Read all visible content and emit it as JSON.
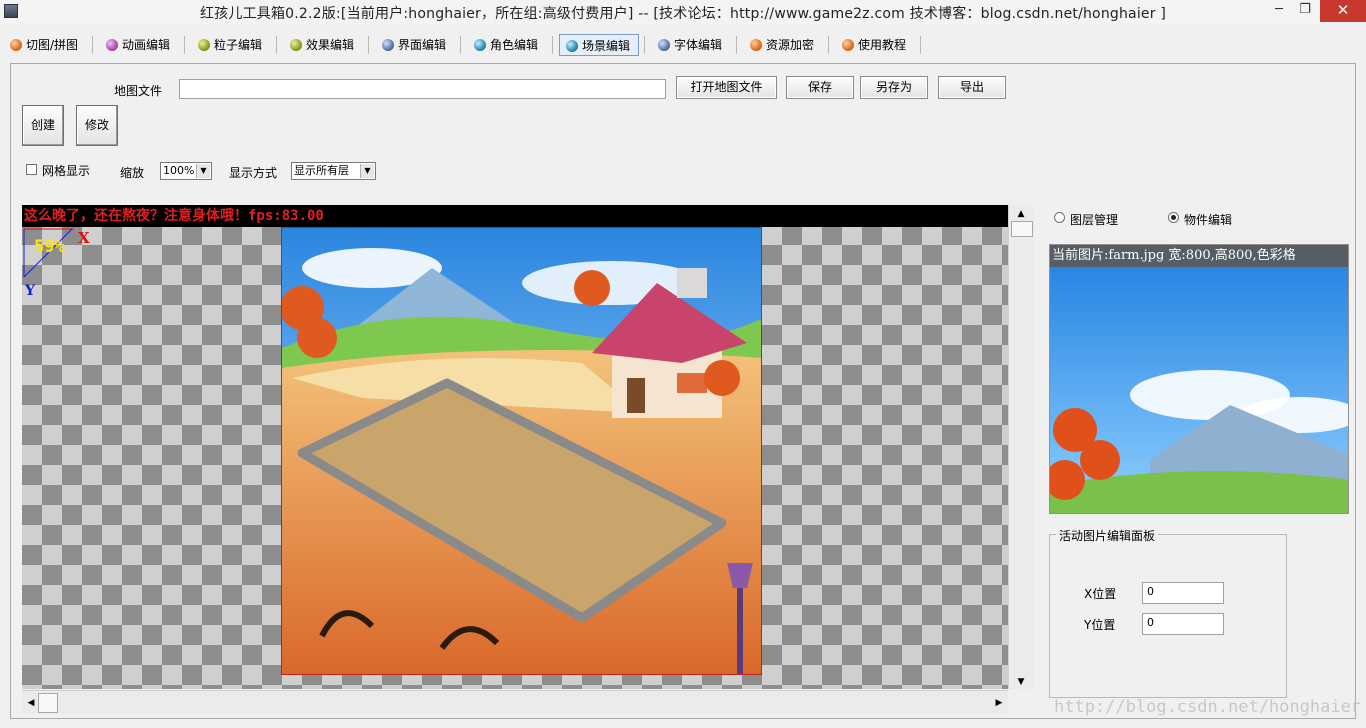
{
  "window": {
    "title": "红孩儿工具箱0.2.2版:[当前用户:honghaier，所在组:高级付费用户]  --  [技术论坛：http://www.game2z.com 技术博客：blog.csdn.net/honghaier ]",
    "min_glyph": "─",
    "max_glyph": "❐",
    "close_glyph": "✕"
  },
  "tabs": [
    {
      "label": "切图/拼图",
      "icon": "orange-ball-icon",
      "color": "#e07020"
    },
    {
      "label": "动画编辑",
      "icon": "purple-ball-icon",
      "color": "#b04bb0"
    },
    {
      "label": "粒子编辑",
      "icon": "olive-ball-icon",
      "color": "#8ea020"
    },
    {
      "label": "效果编辑",
      "icon": "olive-ball-icon",
      "color": "#8ea020"
    },
    {
      "label": "界面编辑",
      "icon": "steel-ball-icon",
      "color": "#5a78a8"
    },
    {
      "label": "角色编辑",
      "icon": "teal-ball-icon",
      "color": "#2f8fb0"
    },
    {
      "label": "场景编辑",
      "icon": "teal-ball-icon",
      "color": "#2f8fb0"
    },
    {
      "label": "字体编辑",
      "icon": "steel-ball-icon",
      "color": "#5a78a8"
    },
    {
      "label": "资源加密",
      "icon": "orange-ball-icon",
      "color": "#e07020"
    },
    {
      "label": "使用教程",
      "icon": "orange-ball-icon",
      "color": "#e07020"
    }
  ],
  "map_file": {
    "label": "地图文件",
    "value": "",
    "open_label": "打开地图文件",
    "save_label": "保存",
    "save_as_label": "另存为",
    "export_label": "导出"
  },
  "actions": {
    "create_label": "创建",
    "modify_label": "修改"
  },
  "view_options": {
    "grid_label": "网格显示",
    "grid_checked": false,
    "zoom_label": "缩放",
    "zoom_value": "100%",
    "display_mode_label": "显示方式",
    "display_mode_value": "显示所有层"
  },
  "canvas": {
    "status_text": "这么晚了，还在熬夜？注意身体哦！fps:83.00",
    "zoom_badge": "59%",
    "axis_x": "X",
    "axis_y": "Y"
  },
  "scroll": {
    "up_glyph": "▲",
    "down_glyph": "▼",
    "left_glyph": "◀",
    "right_glyph": "▶"
  },
  "right_panel": {
    "layer_mode_label": "图层管理",
    "object_mode_label": "物件编辑",
    "selected_mode": "object",
    "preview_caption": "当前图片:farm.jpg 宽:800,高800,色彩格",
    "group_title": "活动图片编辑面板",
    "x_label": "X位置",
    "x_value": "0",
    "y_label": "Y位置",
    "y_value": "0"
  },
  "watermark": "http://blog.csdn.net/honghaier"
}
